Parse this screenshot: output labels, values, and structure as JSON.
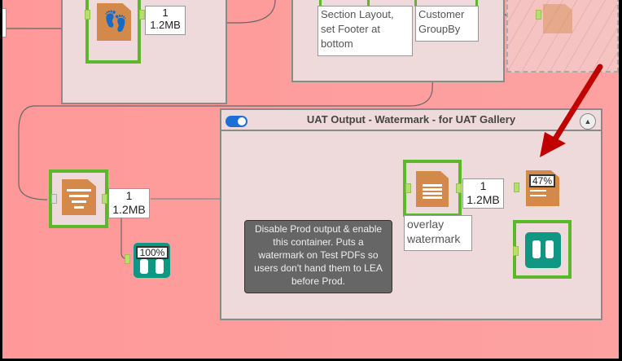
{
  "top_left_tool": {
    "count": "1",
    "size": "1.2MB"
  },
  "middle_container": {
    "labels": [
      "Section Layout, set Footer at bottom",
      "Customer GroupBy"
    ]
  },
  "uat_container": {
    "title": "UAT Output - Watermark - for UAT Gallery",
    "toggle_on": true
  },
  "overlay_tool": {
    "label": "overlay watermark",
    "count": "1",
    "size": "1.2MB"
  },
  "render_tool": {
    "progress": "47%"
  },
  "left_filter_tool": {
    "count": "1",
    "size": "1.2MB"
  },
  "browse_tool_left": {
    "progress": "100%"
  },
  "comment": {
    "text": "Disable Prod output & enable this container. Puts a watermark on Test PDFs so users don't hand them to LEA before Prod."
  },
  "colors": {
    "canvas": "#fda1a1",
    "container": "#efdadb",
    "tool_selected": "#5cb82a",
    "arrow": "#c00000",
    "comment_bg": "#666666"
  }
}
